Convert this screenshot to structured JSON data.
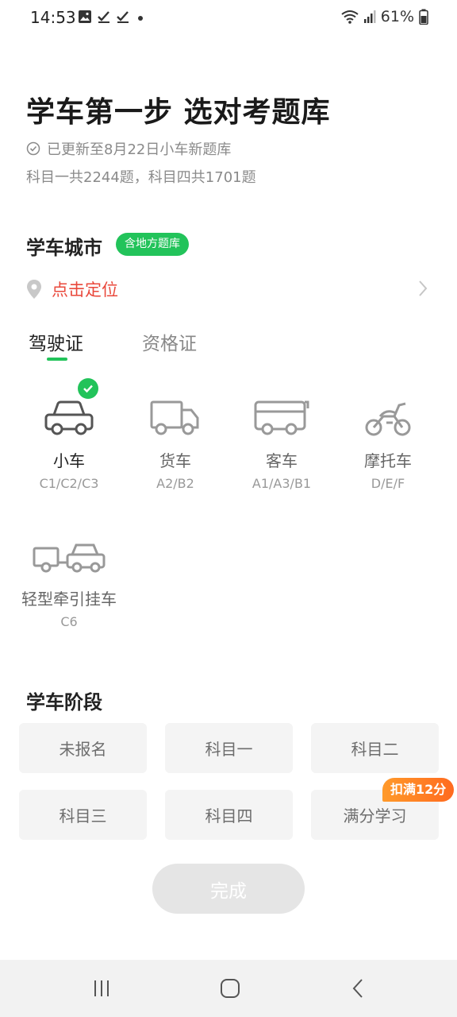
{
  "status_bar": {
    "time": "14:53",
    "battery": "61%"
  },
  "header": {
    "title": "学车第一步 选对考题库",
    "update_info": "已更新至8月22日小车新题库",
    "question_counts": "科目一共2244题，科目四共1701题"
  },
  "city": {
    "section_title": "学车城市",
    "badge": "含地方题库",
    "locate_label": "点击定位"
  },
  "tabs": [
    {
      "label": "驾驶证",
      "active": true
    },
    {
      "label": "资格证",
      "active": false
    }
  ],
  "vehicles": [
    {
      "name": "小车",
      "code": "C1/C2/C3",
      "icon": "car-icon",
      "selected": true
    },
    {
      "name": "货车",
      "code": "A2/B2",
      "icon": "truck-icon",
      "selected": false
    },
    {
      "name": "客车",
      "code": "A1/A3/B1",
      "icon": "bus-icon",
      "selected": false
    },
    {
      "name": "摩托车",
      "code": "D/E/F",
      "icon": "motorcycle-icon",
      "selected": false
    },
    {
      "name": "轻型牵引挂车",
      "code": "C6",
      "icon": "trailer-icon",
      "selected": false
    }
  ],
  "stage": {
    "section_title": "学车阶段",
    "options": [
      "未报名",
      "科目一",
      "科目二",
      "科目三",
      "科目四",
      "满分学习"
    ],
    "promo_badge": "扣满12分"
  },
  "done_button": "完成",
  "colors": {
    "accent_green": "#22c35a",
    "locate_red": "#e9483b",
    "promo_orange": "#ff7a22"
  }
}
